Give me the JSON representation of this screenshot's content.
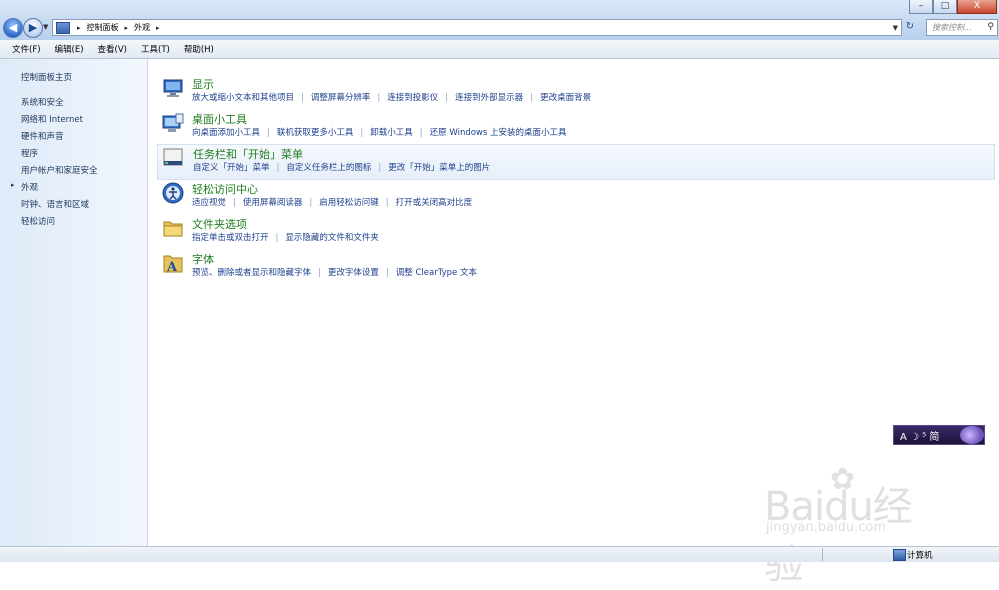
{
  "window": {
    "minimize": "–",
    "maximize": "□",
    "close": "X"
  },
  "address": {
    "crumbs": [
      "控制面板",
      "外观"
    ],
    "search_placeholder": "搜索控制..."
  },
  "menu": [
    "文件(F)",
    "编辑(E)",
    "查看(V)",
    "工具(T)",
    "帮助(H)"
  ],
  "sidebar": {
    "home": "控制面板主页",
    "items": [
      "系统和安全",
      "网络和 Internet",
      "硬件和声音",
      "程序",
      "用户帐户和家庭安全",
      "外观",
      "时钟、语言和区域",
      "轻松访问"
    ],
    "current_index": 5
  },
  "categories": [
    {
      "title": "显示",
      "icon": "monitor-icon",
      "links": [
        "放大或缩小文本和其他项目",
        "调整屏幕分辨率",
        "连接到投影仪",
        "连接到外部显示器",
        "更改桌面背景"
      ]
    },
    {
      "title": "桌面小工具",
      "icon": "gadgets-icon",
      "links": [
        "向桌面添加小工具",
        "联机获取更多小工具",
        "卸载小工具",
        "还原 Windows 上安装的桌面小工具"
      ]
    },
    {
      "title": "任务栏和「开始」菜单",
      "icon": "taskbar-icon",
      "links": [
        "自定义「开始」菜单",
        "自定义任务栏上的图标",
        "更改「开始」菜单上的图片"
      ]
    },
    {
      "title": "轻松访问中心",
      "icon": "ease-of-access-icon",
      "links": [
        "适应视觉",
        "使用屏幕阅读器",
        "启用轻松访问键",
        "打开或关闭高对比度"
      ]
    },
    {
      "title": "文件夹选项",
      "icon": "folder-icon",
      "links": [
        "指定单击或双击打开",
        "显示隐藏的文件和文件夹"
      ]
    },
    {
      "title": "字体",
      "icon": "fonts-icon",
      "links": [
        "预览、删除或者显示和隐藏字体",
        "更改字体设置",
        "调整 ClearType 文本"
      ]
    }
  ],
  "ime": {
    "label": "A ☽ ⁵ 简"
  },
  "status": {
    "label": "计算机"
  },
  "watermark": {
    "brand": "Baidu经验",
    "url": "jingyan.baidu.com"
  },
  "colors": {
    "category_title": "#1e7d1e",
    "link": "#1c3f8c",
    "sidebar_bg": "#e4eef9"
  }
}
